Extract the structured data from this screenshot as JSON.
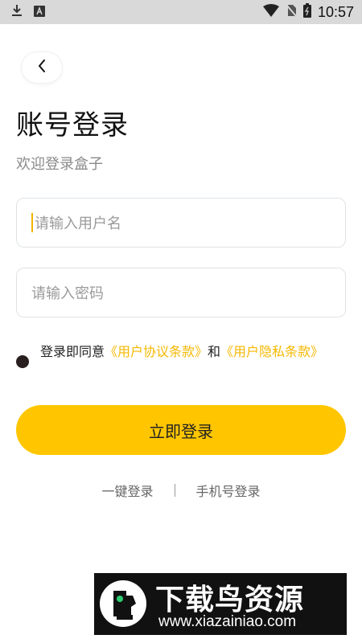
{
  "status_bar": {
    "time": "10:57",
    "icons": [
      "download-icon",
      "keyboard-a-icon",
      "wifi-icon",
      "no-sim-icon",
      "battery-icon"
    ]
  },
  "header": {
    "back_icon": "chevron-left-icon",
    "title": "账号登录",
    "subtitle": "欢迎登录盒子"
  },
  "form": {
    "username_placeholder": "请输入用户名",
    "password_placeholder": "请输入密码"
  },
  "agreement": {
    "prefix": "登录即同意",
    "user_agreement": "《用户协议条款》",
    "connector": "和",
    "privacy_policy": "《用户隐私条款》"
  },
  "login_button": "立即登录",
  "alt_login": {
    "one_click": "一键登录",
    "phone": "手机号登录"
  },
  "watermark": {
    "cn": "下载鸟资源",
    "en": "www.xiazainiao.com"
  },
  "colors": {
    "accent": "#ffc600",
    "link": "#f5b800",
    "status_bar_bg": "#d9d9d9"
  }
}
